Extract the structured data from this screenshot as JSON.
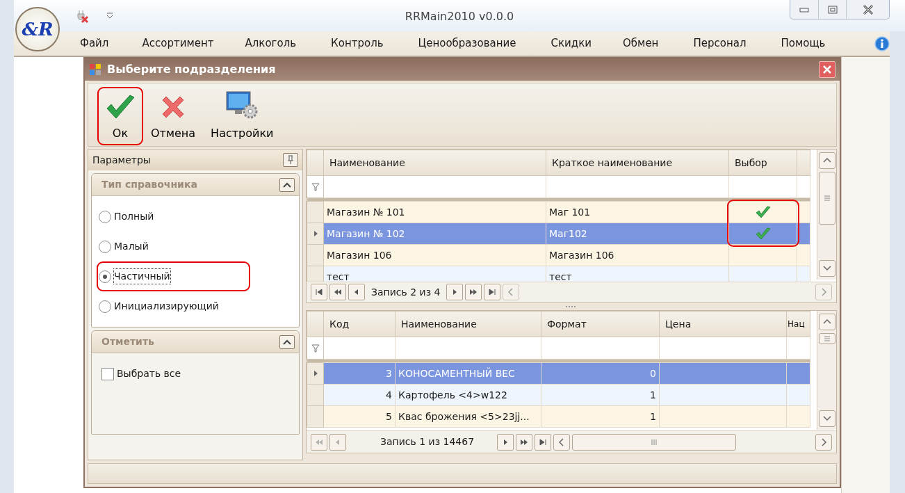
{
  "app": {
    "title": "RRMain2010 v0.0.0",
    "logo_text": "&R"
  },
  "menu": [
    "Файл",
    "Ассортимент",
    "Алкоголь",
    "Контроль",
    "Ценообразование",
    "Скидки",
    "Обмен",
    "Персонал",
    "Помощь"
  ],
  "dialog": {
    "title": "Выберите подразделения"
  },
  "toolbar": [
    {
      "kind": "ok",
      "label": "Ок",
      "highlighted": true
    },
    {
      "kind": "cancel",
      "label": "Отмена",
      "highlighted": false
    },
    {
      "kind": "settings",
      "label": "Настройки",
      "highlighted": false
    }
  ],
  "parameters_panel": {
    "title": "Параметры",
    "groups": [
      {
        "kind": "radio",
        "title": "Тип справочника",
        "options": [
          {
            "label": "Полный",
            "selected": false,
            "highlighted": false
          },
          {
            "label": "Малый",
            "selected": false,
            "highlighted": false
          },
          {
            "label": "Частичный",
            "selected": true,
            "highlighted": true
          },
          {
            "label": "Инициализирующий",
            "selected": false,
            "highlighted": false
          }
        ]
      },
      {
        "kind": "checkbox",
        "title": "Отметить",
        "options": [
          {
            "label": "Выбрать все",
            "checked": false
          }
        ]
      }
    ]
  },
  "top_grid": {
    "columns": [
      "Наименование",
      "Краткое наименование",
      "Выбор"
    ],
    "rows": [
      {
        "name": "Магазин № 101",
        "short_name": "Маг 101",
        "chosen": true,
        "selected": false,
        "highlighted": true
      },
      {
        "name": "Магазин № 102",
        "short_name": "Маг102",
        "chosen": true,
        "selected": true,
        "highlighted": true
      },
      {
        "name": "Магазин 106",
        "short_name": "Магазин 106",
        "chosen": false,
        "selected": false,
        "highlighted": false
      },
      {
        "name": "тест",
        "short_name": "тест",
        "chosen": false,
        "selected": false,
        "highlighted": false
      }
    ],
    "record_text": "Запись 2 из 4"
  },
  "bottom_grid": {
    "columns": [
      "Код",
      "Наименование",
      "Формат",
      "Цена",
      "Нац"
    ],
    "rows": [
      {
        "code": "3",
        "name": "КОНОСАМЕНТНЫЙ ВЕС",
        "format": "0",
        "selected": true
      },
      {
        "code": "4",
        "name": "Картофель  <4>w122",
        "format": "1",
        "selected": false
      },
      {
        "code": "5",
        "name": "Квас брожения  <5>23jj...",
        "format": "1",
        "selected": false
      }
    ],
    "record_text": "Запись 1 из 14467"
  }
}
